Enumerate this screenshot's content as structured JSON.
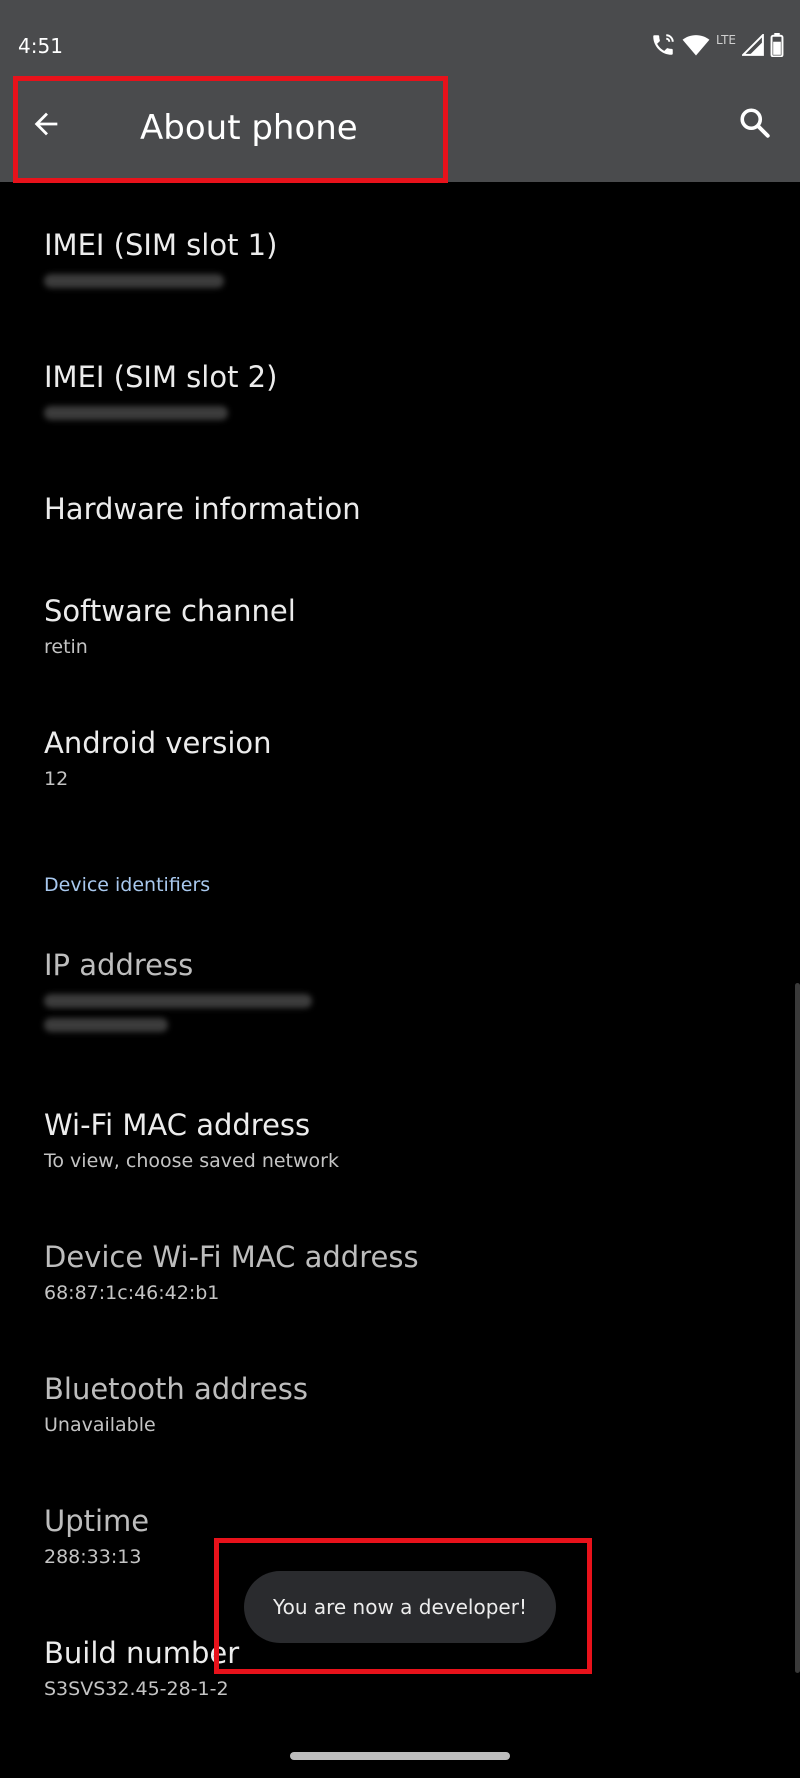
{
  "status_bar": {
    "time": "4:51",
    "network_label": "LTE",
    "icons": [
      "wifi-calling-icon",
      "wifi-icon",
      "signal-icon",
      "battery-icon"
    ]
  },
  "app_bar": {
    "title": "About phone",
    "back_icon": "arrow-left-icon",
    "search_icon": "search-icon"
  },
  "items": {
    "imei1": {
      "title": "IMEI (SIM slot 1)"
    },
    "imei2": {
      "title": "IMEI (SIM slot 2)"
    },
    "hardware": {
      "title": "Hardware information"
    },
    "software_channel": {
      "title": "Software channel",
      "value": "retin"
    },
    "android_version": {
      "title": "Android version",
      "value": "12"
    },
    "section_header": "Device identifiers",
    "ip_address": {
      "title": "IP address"
    },
    "wifi_mac": {
      "title": "Wi-Fi MAC address",
      "value": "To view, choose saved network"
    },
    "device_wifi_mac": {
      "title": "Device Wi-Fi MAC address",
      "value": "68:87:1c:46:42:b1"
    },
    "bluetooth": {
      "title": "Bluetooth address",
      "value": "Unavailable"
    },
    "uptime": {
      "title": "Uptime",
      "value": "288:33:13"
    },
    "build_number": {
      "title": "Build number",
      "value": "S3SVS32.45-28-1-2"
    }
  },
  "toast": {
    "message": "You are now a developer!"
  },
  "colors": {
    "app_bar_bg": "#4a4b4d",
    "background": "#000000",
    "section_header": "#a8c8ee",
    "highlight": "#e8121b",
    "toast_bg": "#2a2b2e"
  }
}
